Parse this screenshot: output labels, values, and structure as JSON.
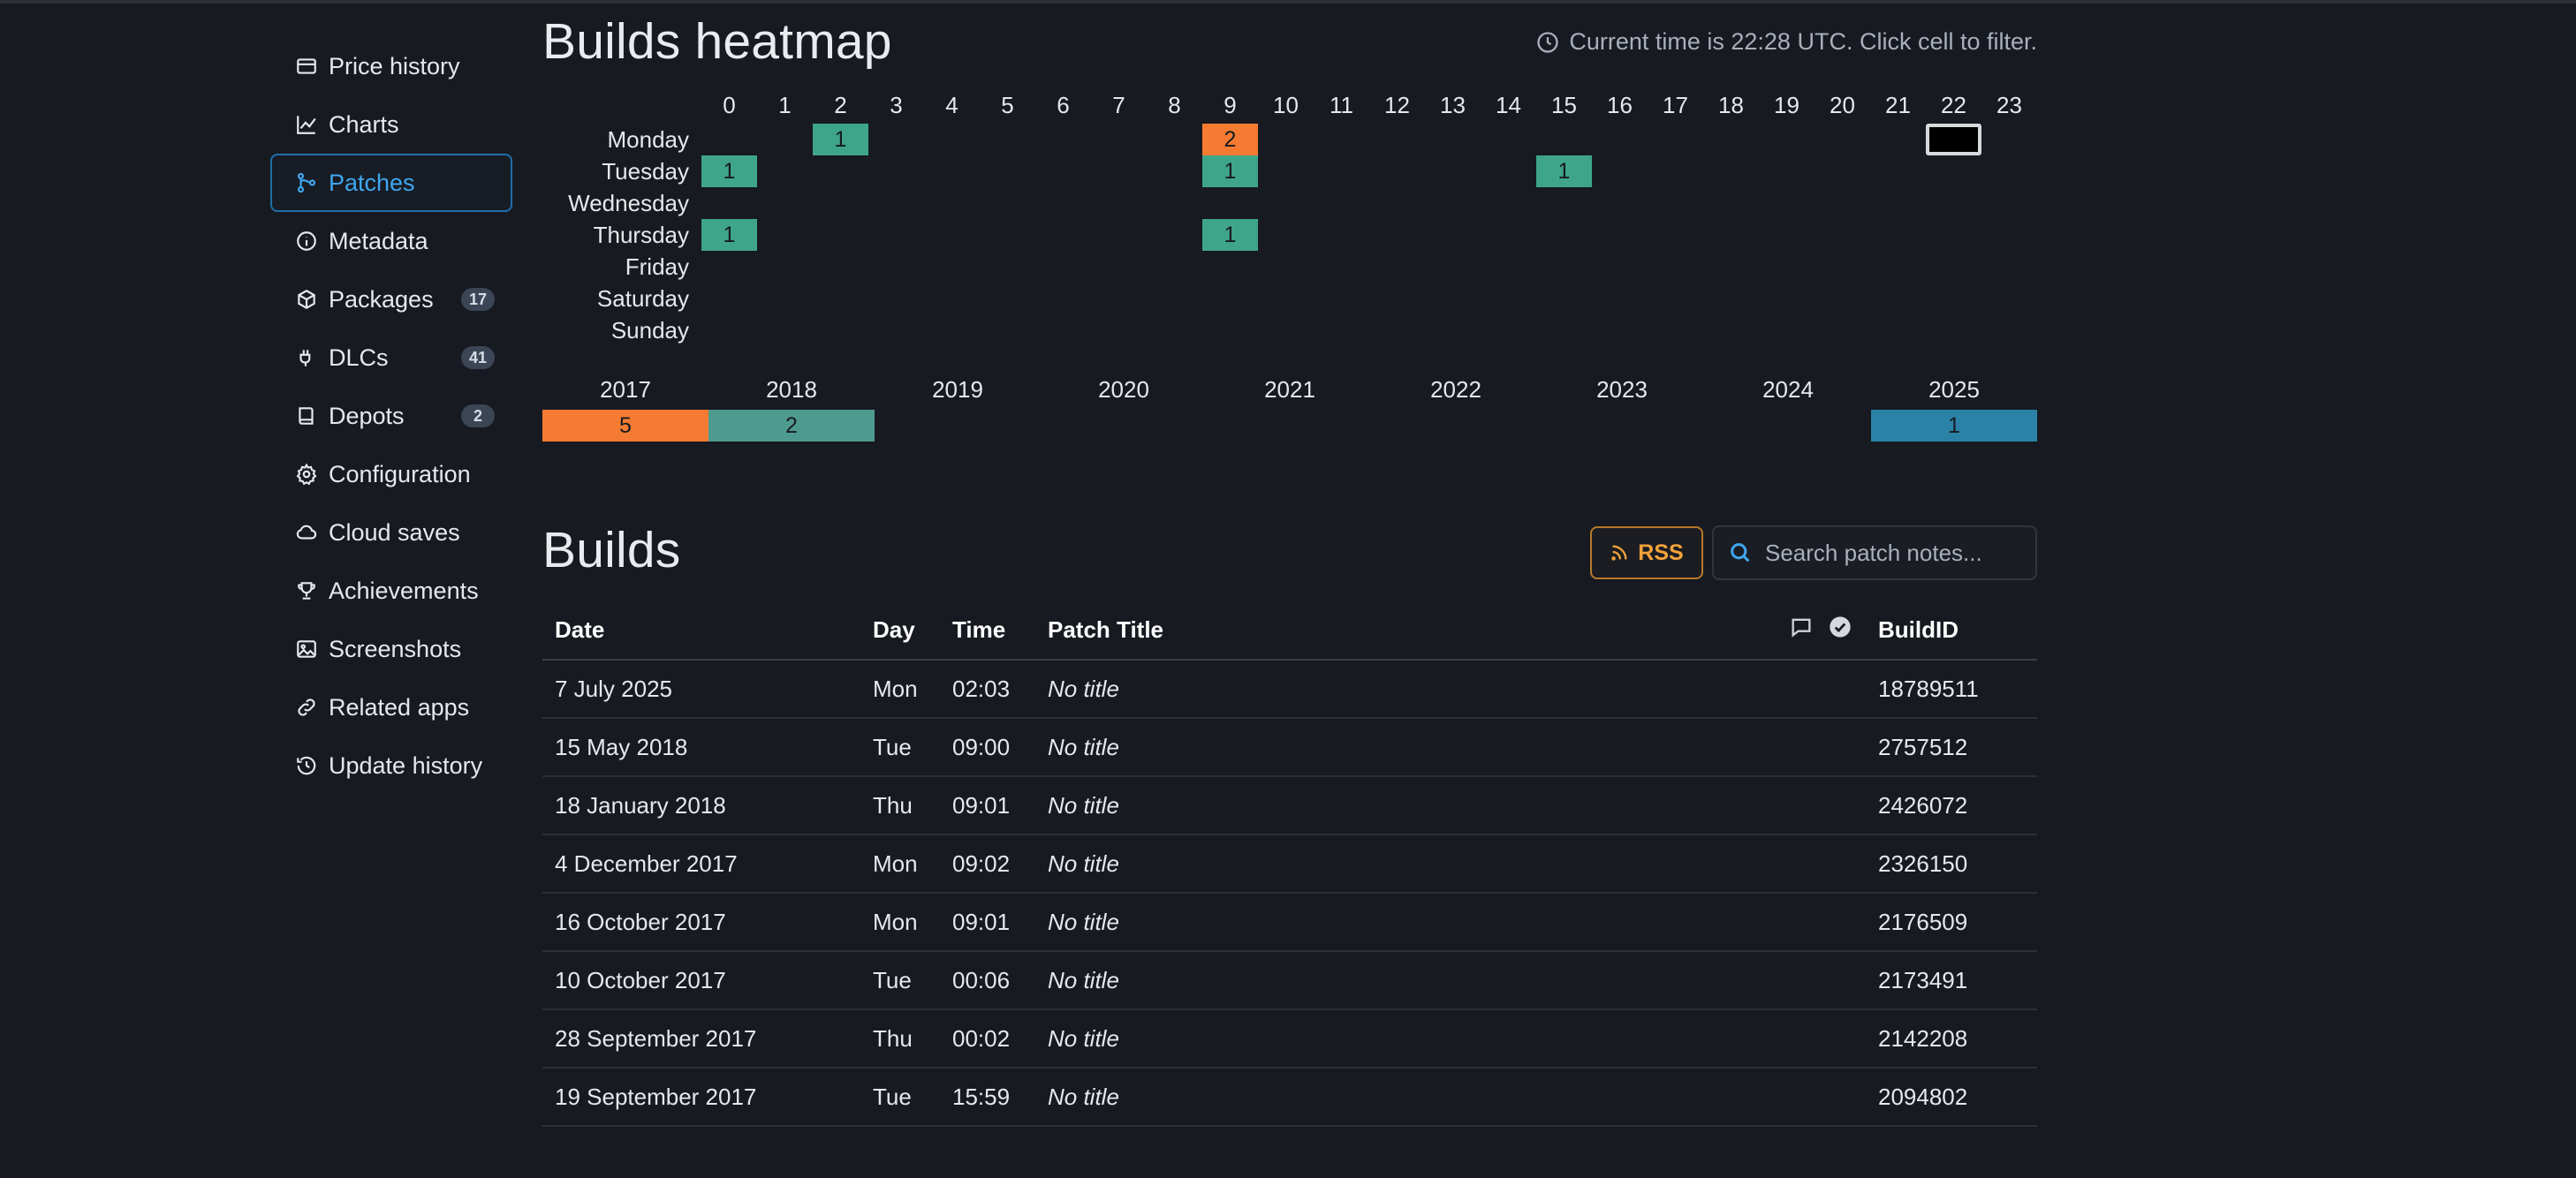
{
  "sidebar": {
    "items": [
      {
        "label": "Price history",
        "icon": "price-tag-icon"
      },
      {
        "label": "Charts",
        "icon": "line-chart-icon"
      },
      {
        "label": "Patches",
        "icon": "git-branch-icon",
        "active": true
      },
      {
        "label": "Metadata",
        "icon": "info-icon"
      },
      {
        "label": "Packages",
        "icon": "package-icon",
        "badge": "17"
      },
      {
        "label": "DLCs",
        "icon": "plug-icon",
        "badge": "41"
      },
      {
        "label": "Depots",
        "icon": "book-icon",
        "badge": "2"
      },
      {
        "label": "Configuration",
        "icon": "gear-icon"
      },
      {
        "label": "Cloud saves",
        "icon": "cloud-icon"
      },
      {
        "label": "Achievements",
        "icon": "trophy-icon"
      },
      {
        "label": "Screenshots",
        "icon": "image-icon"
      },
      {
        "label": "Related apps",
        "icon": "link-icon"
      },
      {
        "label": "Update history",
        "icon": "history-icon"
      }
    ]
  },
  "heatmap": {
    "title": "Builds heatmap",
    "current_time_text": "Current time is 22:28 UTC. Click cell to filter.",
    "hours": [
      "0",
      "1",
      "2",
      "3",
      "4",
      "5",
      "6",
      "7",
      "8",
      "9",
      "10",
      "11",
      "12",
      "13",
      "14",
      "15",
      "16",
      "17",
      "18",
      "19",
      "20",
      "21",
      "22",
      "23"
    ],
    "days": [
      "Monday",
      "Tuesday",
      "Wednesday",
      "Thursday",
      "Friday",
      "Saturday",
      "Sunday"
    ],
    "cells": [
      {
        "day": 0,
        "hour": 2,
        "count": "1",
        "color": "#3ea58a"
      },
      {
        "day": 0,
        "hour": 9,
        "count": "2",
        "color": "#f47b31"
      },
      {
        "day": 1,
        "hour": 0,
        "count": "1",
        "color": "#3ea58a"
      },
      {
        "day": 1,
        "hour": 9,
        "count": "1",
        "color": "#3ea58a"
      },
      {
        "day": 1,
        "hour": 15,
        "count": "1",
        "color": "#3ea58a"
      },
      {
        "day": 3,
        "hour": 0,
        "count": "1",
        "color": "#3ea58a"
      },
      {
        "day": 3,
        "hour": 9,
        "count": "1",
        "color": "#3ea58a"
      }
    ],
    "current_cell": {
      "day": 0,
      "hour": 22
    },
    "years": [
      "2017",
      "2018",
      "2019",
      "2020",
      "2021",
      "2022",
      "2023",
      "2024",
      "2025"
    ],
    "year_counts": [
      {
        "year_index": 0,
        "count": "5",
        "color": "#f47b31"
      },
      {
        "year_index": 1,
        "count": "2",
        "color": "#4f9a8e"
      },
      {
        "year_index": 8,
        "count": "1",
        "color": "#2a83a6"
      }
    ]
  },
  "builds": {
    "title": "Builds",
    "rss_label": "RSS",
    "search_placeholder": "Search patch notes...",
    "columns": {
      "date": "Date",
      "day": "Day",
      "time": "Time",
      "patch_title": "Patch Title",
      "build_id": "BuildID"
    },
    "rows": [
      {
        "date": "7 July 2025",
        "day": "Mon",
        "time": "02:03",
        "title": "No title",
        "build_id": "18789511"
      },
      {
        "date": "15 May 2018",
        "day": "Tue",
        "time": "09:00",
        "title": "No title",
        "build_id": "2757512"
      },
      {
        "date": "18 January 2018",
        "day": "Thu",
        "time": "09:01",
        "title": "No title",
        "build_id": "2426072"
      },
      {
        "date": "4 December 2017",
        "day": "Mon",
        "time": "09:02",
        "title": "No title",
        "build_id": "2326150"
      },
      {
        "date": "16 October 2017",
        "day": "Mon",
        "time": "09:01",
        "title": "No title",
        "build_id": "2176509"
      },
      {
        "date": "10 October 2017",
        "day": "Tue",
        "time": "00:06",
        "title": "No title",
        "build_id": "2173491"
      },
      {
        "date": "28 September 2017",
        "day": "Thu",
        "time": "00:02",
        "title": "No title",
        "build_id": "2142208"
      },
      {
        "date": "19 September 2017",
        "day": "Tue",
        "time": "15:59",
        "title": "No title",
        "build_id": "2094802"
      }
    ]
  }
}
